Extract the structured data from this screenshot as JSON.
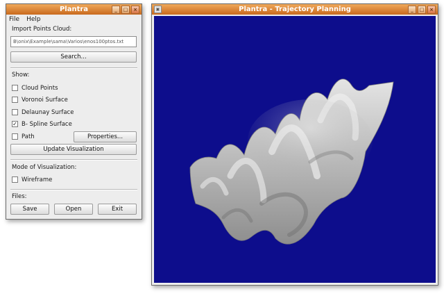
{
  "control_window": {
    "title": "Plantra",
    "menu": [
      "File",
      "Help"
    ],
    "import_label": "Import Points Cloud:",
    "path_value": "B\\onix\\Example\\sama\\Varios\\enos100ptos.txt",
    "search_label": "Search...",
    "show_label": "Show:",
    "checkboxes": [
      {
        "label": "Cloud Points",
        "checked": false
      },
      {
        "label": "Voronoi Surface",
        "checked": false
      },
      {
        "label": "Delaunay Surface",
        "checked": false
      },
      {
        "label": "B- Spline Surface",
        "checked": true
      },
      {
        "label": "Path",
        "checked": false
      }
    ],
    "properties_label": "Properties...",
    "update_label": "Update Visualization",
    "mode_label": "Mode of Visualization:",
    "wireframe_label": "Wireframe",
    "wireframe_checked": false,
    "files_label": "Files:",
    "save_label": "Save",
    "open_label": "Open",
    "exit_label": "Exit"
  },
  "viz_window": {
    "title": "Plantra - Trajectory Planning",
    "background_color": "#0d0d8c",
    "surface_color": "#a8a8a8"
  }
}
